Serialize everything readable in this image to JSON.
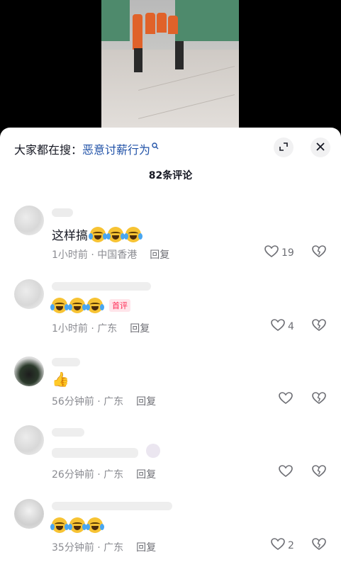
{
  "search": {
    "prefix": "大家都在搜：",
    "term": "恶意讨薪行为"
  },
  "comments_count": "82条评论",
  "comments": [
    {
      "body": "这样搞",
      "emoji_count": 3,
      "time": "1小时前 · 中国香港",
      "reply": "回复",
      "likes": "19"
    },
    {
      "body": "",
      "emoji_count": 3,
      "badge": "首评",
      "time": "1小时前 · 广东",
      "reply": "回复",
      "likes": "4"
    },
    {
      "body": "",
      "emoji": "👍",
      "time": "56分钟前 · 广东",
      "reply": "回复",
      "likes": ""
    },
    {
      "body": "",
      "time": "26分钟前 · 广东",
      "reply": "回复",
      "likes": ""
    },
    {
      "body": "",
      "emoji_count": 3,
      "time": "35分钟前 · 广东",
      "reply": "回复",
      "likes": "2"
    }
  ],
  "icons": {
    "search_mark": "search-icon",
    "expand": "expand-icon",
    "close": "close-icon",
    "like": "heart-outline-icon",
    "dislike": "broken-heart-icon"
  },
  "colors": {
    "search_term": "#2253a8",
    "badge": "#fe2c55"
  }
}
